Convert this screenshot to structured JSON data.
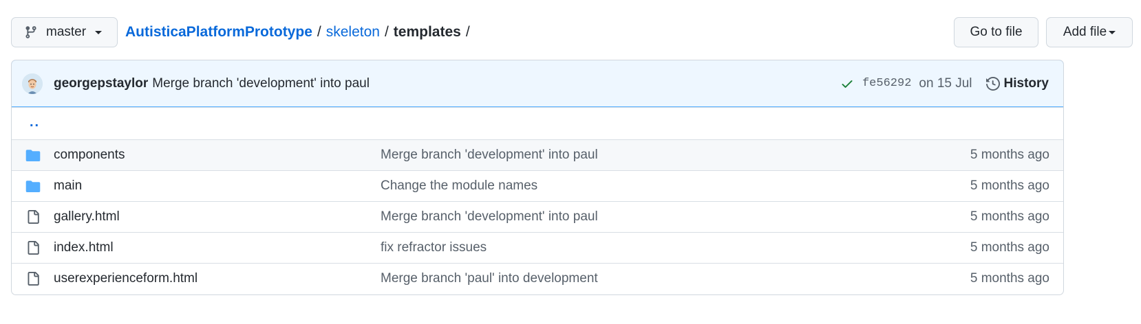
{
  "branch": {
    "label": "master",
    "icon": "branch-icon"
  },
  "breadcrumb": {
    "repo": "AutisticaPlatformPrototype",
    "path1": "skeleton",
    "current": "templates",
    "separator": "/"
  },
  "actions": {
    "go_to_file": "Go to file",
    "add_file": "Add file"
  },
  "commit": {
    "author": "georgepstaylor",
    "message": "Merge branch 'development' into paul",
    "sha": "fe56292",
    "date": "on 15 Jul",
    "history_label": "History",
    "status_color": "#1a7f37"
  },
  "parent_link": "..",
  "files": [
    {
      "name": "components",
      "type": "folder",
      "message": "Merge branch 'development' into paul",
      "age": "5 months ago"
    },
    {
      "name": "main",
      "type": "folder",
      "message": "Change the module names",
      "age": "5 months ago"
    },
    {
      "name": "gallery.html",
      "type": "file",
      "message": "Merge branch 'development' into paul",
      "age": "5 months ago"
    },
    {
      "name": "index.html",
      "type": "file",
      "message": "fix refractor issues",
      "age": "5 months ago"
    },
    {
      "name": "userexperienceform.html",
      "type": "file",
      "message": "Merge branch 'paul' into development",
      "age": "5 months ago"
    }
  ],
  "colors": {
    "link": "#0969da",
    "folder": "#54aeff",
    "commit_bg": "#eef7ff"
  }
}
